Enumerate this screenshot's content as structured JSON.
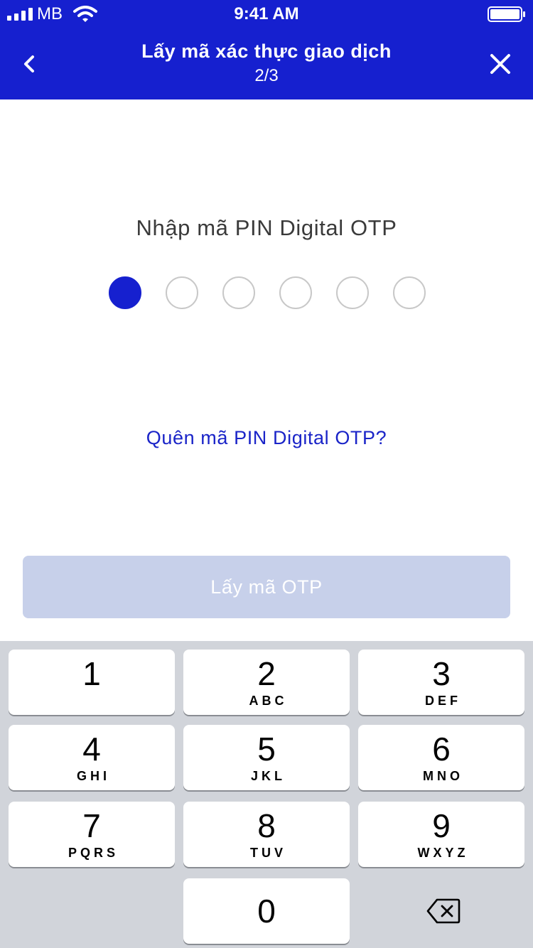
{
  "status_bar": {
    "carrier": "MB",
    "time": "9:41 AM",
    "icons": [
      "signal-icon",
      "wifi-icon",
      "battery-icon"
    ]
  },
  "header": {
    "title": "Lấy mã xác thực giao dịch",
    "step": "2/3",
    "back_icon": "chevron-left-icon",
    "close_icon": "close-icon",
    "background_color": "#1620cf"
  },
  "pin": {
    "prompt": "Nhập mã PIN Digital OTP",
    "length": 6,
    "filled": 1,
    "filled_color": "#1620cf"
  },
  "forgot_link": "Quên mã PIN Digital OTP?",
  "get_otp_button": {
    "label": "Lấy mã OTP",
    "enabled": false,
    "color": "#c7d0ea"
  },
  "keypad": {
    "keys": [
      {
        "digit": "1",
        "letters": ""
      },
      {
        "digit": "2",
        "letters": "ABC"
      },
      {
        "digit": "3",
        "letters": "DEF"
      },
      {
        "digit": "4",
        "letters": "GHI"
      },
      {
        "digit": "5",
        "letters": "JKL"
      },
      {
        "digit": "6",
        "letters": "MNO"
      },
      {
        "digit": "7",
        "letters": "PQRS"
      },
      {
        "digit": "8",
        "letters": "TUV"
      },
      {
        "digit": "9",
        "letters": "WXYZ"
      },
      {
        "digit": "0",
        "letters": ""
      }
    ],
    "delete_icon": "backspace-icon",
    "background_color": "#d1d4da"
  }
}
